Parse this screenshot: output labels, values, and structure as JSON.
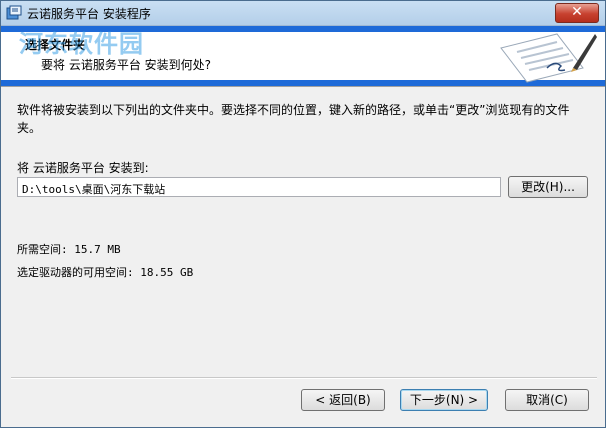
{
  "window": {
    "title": "云诺服务平台 安装程序",
    "close_label": "✕"
  },
  "banner": {
    "title": "选择文件夹",
    "subtitle": "要将 云诺服务平台 安装到何处?",
    "watermark": "河东软件园"
  },
  "content": {
    "intro": "软件将被安装到以下列出的文件夹中。要选择不同的位置，键入新的路径，或单击“更改”浏览现有的文件夹。",
    "path_label": "将 云诺服务平台 安装到:",
    "path_value": "D:\\tools\\桌面\\河东下载站",
    "browse_label": "更改(H)...",
    "space_required": "所需空间: 15.7 MB",
    "space_available": "选定驱动器的可用空间: 18.55 GB"
  },
  "footer": {
    "back_label": "< 返回(B)",
    "next_label": "下一步(N) >",
    "cancel_label": "取消(C)"
  },
  "icons": {
    "app": "installer-icon",
    "banner_art": "document-pen-icon"
  },
  "colors": {
    "banner_blue": "#1e6ad8",
    "close_red": "#c7412f"
  }
}
